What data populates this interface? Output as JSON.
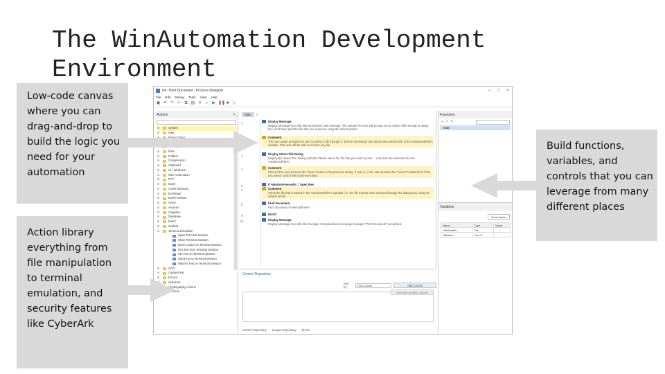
{
  "slide": {
    "title_line1": "The WinAutomation Development",
    "title_line2": "Environment",
    "callout_canvas": "Low-code canvas where you can drag-and-drop to build the logic you need for your automation",
    "callout_actions": "Action library everything from file manipulation to terminal emulation, and security features like CyberArk",
    "callout_functions": "Build functions, variables, and controls that you can leverage from many different places"
  },
  "window": {
    "title": "04 - Print Document - Process Designer",
    "menu": [
      "File",
      "Edit",
      "Debug",
      "Tools",
      "View",
      "Help"
    ]
  },
  "actions_pane": {
    "header": "Actions",
    "items": [
      {
        "label": "System",
        "level": 0,
        "selected": true
      },
      {
        "label": "Wait",
        "level": 0
      },
      {
        "label": "Flow Control",
        "level": 0
      },
      {
        "label": "Mouse and Keyboard",
        "level": 0
      },
      {
        "label": "Message Boxes",
        "level": 0
      },
      {
        "label": "Files",
        "level": 0
      },
      {
        "label": "Folders",
        "level": 0
      },
      {
        "label": "Compression",
        "level": 0
      },
      {
        "label": "Clipboard",
        "level": 0
      },
      {
        "label": "UI / Windows",
        "level": 0
      },
      {
        "label": "Web Automation",
        "level": 0
      },
      {
        "label": "FTP",
        "level": 0
      },
      {
        "label": "Excel",
        "level": 0
      },
      {
        "label": "Active Directory",
        "level": 0
      },
      {
        "label": "Exchange",
        "level": 0
      },
      {
        "label": "Email Session",
        "level": 0
      },
      {
        "label": "Azure",
        "level": 0
      },
      {
        "label": "Amazon",
        "level": 0
      },
      {
        "label": "Cognitive",
        "level": 0
      },
      {
        "label": "Database",
        "level": 0
      },
      {
        "label": "Event",
        "level": 0
      },
      {
        "label": "Outlook",
        "level": 0
      },
      {
        "label": "Terminal Emulation",
        "level": 0
      },
      {
        "label": "Open Terminal Session",
        "level": 1
      },
      {
        "label": "Close Terminal Session",
        "level": 1
      },
      {
        "label": "Move Cursor on Terminal Session",
        "level": 1
      },
      {
        "label": "Get Text from Terminal Session",
        "level": 1
      },
      {
        "label": "Set Text on Terminal Session",
        "level": 1
      },
      {
        "label": "Send Key to Terminal Session",
        "level": 1
      },
      {
        "label": "Wait for Text on Terminal Session",
        "level": 1
      },
      {
        "label": "OCR",
        "level": 0
      },
      {
        "label": "CaptureText",
        "level": 0
      },
      {
        "label": "Encore",
        "level": 0
      },
      {
        "label": "CyberArk",
        "level": 0
      },
      {
        "label": "Cryptography Actions",
        "level": 0
      },
      {
        "label": "Services",
        "level": 0
      }
    ]
  },
  "main_pane": {
    "tab": "Main",
    "steps": [
      {
        "num": "1",
        "title": "Display Message",
        "desc": "Display Message box with title Description and message This sample Process will prompt you to select a file through a dialog box, it will then print the file that you selected, using the default printer",
        "comment": false
      },
      {
        "num": "2",
        "title": "Comment",
        "desc": "The next action prompts the user to select a file through a \"Select File Dialog\" and stores the selected file in the %SelectedFile% variable. The user will be able to choose any file.",
        "comment": true
      },
      {
        "num": "3",
        "title": "Display Select File Dialog",
        "desc": "Display the Select File Dialog with title Please select the file that you want to print ... and store the selected file into %SelectedFile%",
        "comment": false
      },
      {
        "num": "4",
        "title": "Comment",
        "desc": "Check if the user pressed the \"Open\" button in the previous dialog. If not (i.e. if the user pressed the \"Cancel\" button) the \"Print Document\" action will not be executed.",
        "comment": true
      },
      {
        "num": "6",
        "title": "If %ButtonPressed% = Open then",
        "desc": "",
        "comment": false
      },
      {
        "num": "7",
        "title": "Comment",
        "desc": "Prints the file that is stored in the %SelectedFile% variable (i.e. the file that the user selected through the dialog box) using the default printer",
        "comment": true
      },
      {
        "num": "8",
        "title": "Print Document",
        "desc": "Print document %SelectedFile%",
        "comment": false
      },
      {
        "num": "9",
        "title": "End If",
        "desc": "",
        "comment": false
      },
      {
        "num": "10",
        "title": "Display Message",
        "desc": "Display Message box with title Example Completed and message Example \"Print Document\" completed",
        "comment": false
      }
    ]
  },
  "repo_pane": {
    "title": "Control Repository",
    "sort_label": "Sort by:",
    "sort_value": "Date Added",
    "add_button": "Add Control",
    "remove_button": "Remove Unused Controls",
    "tabs": [
      "Control Repository",
      "Images Repository",
      "Errors"
    ]
  },
  "functions_pane": {
    "header": "Functions",
    "items": [
      "Main"
    ]
  },
  "variables_pane": {
    "header": "Variables",
    "clear_button": "Clear Values",
    "columns": [
      "Name",
      "Type",
      "Value"
    ],
    "rows": [
      [
        "%SelecteFi...",
        "File",
        ""
      ],
      [
        "%Button...",
        "Text V...",
        ""
      ]
    ]
  }
}
